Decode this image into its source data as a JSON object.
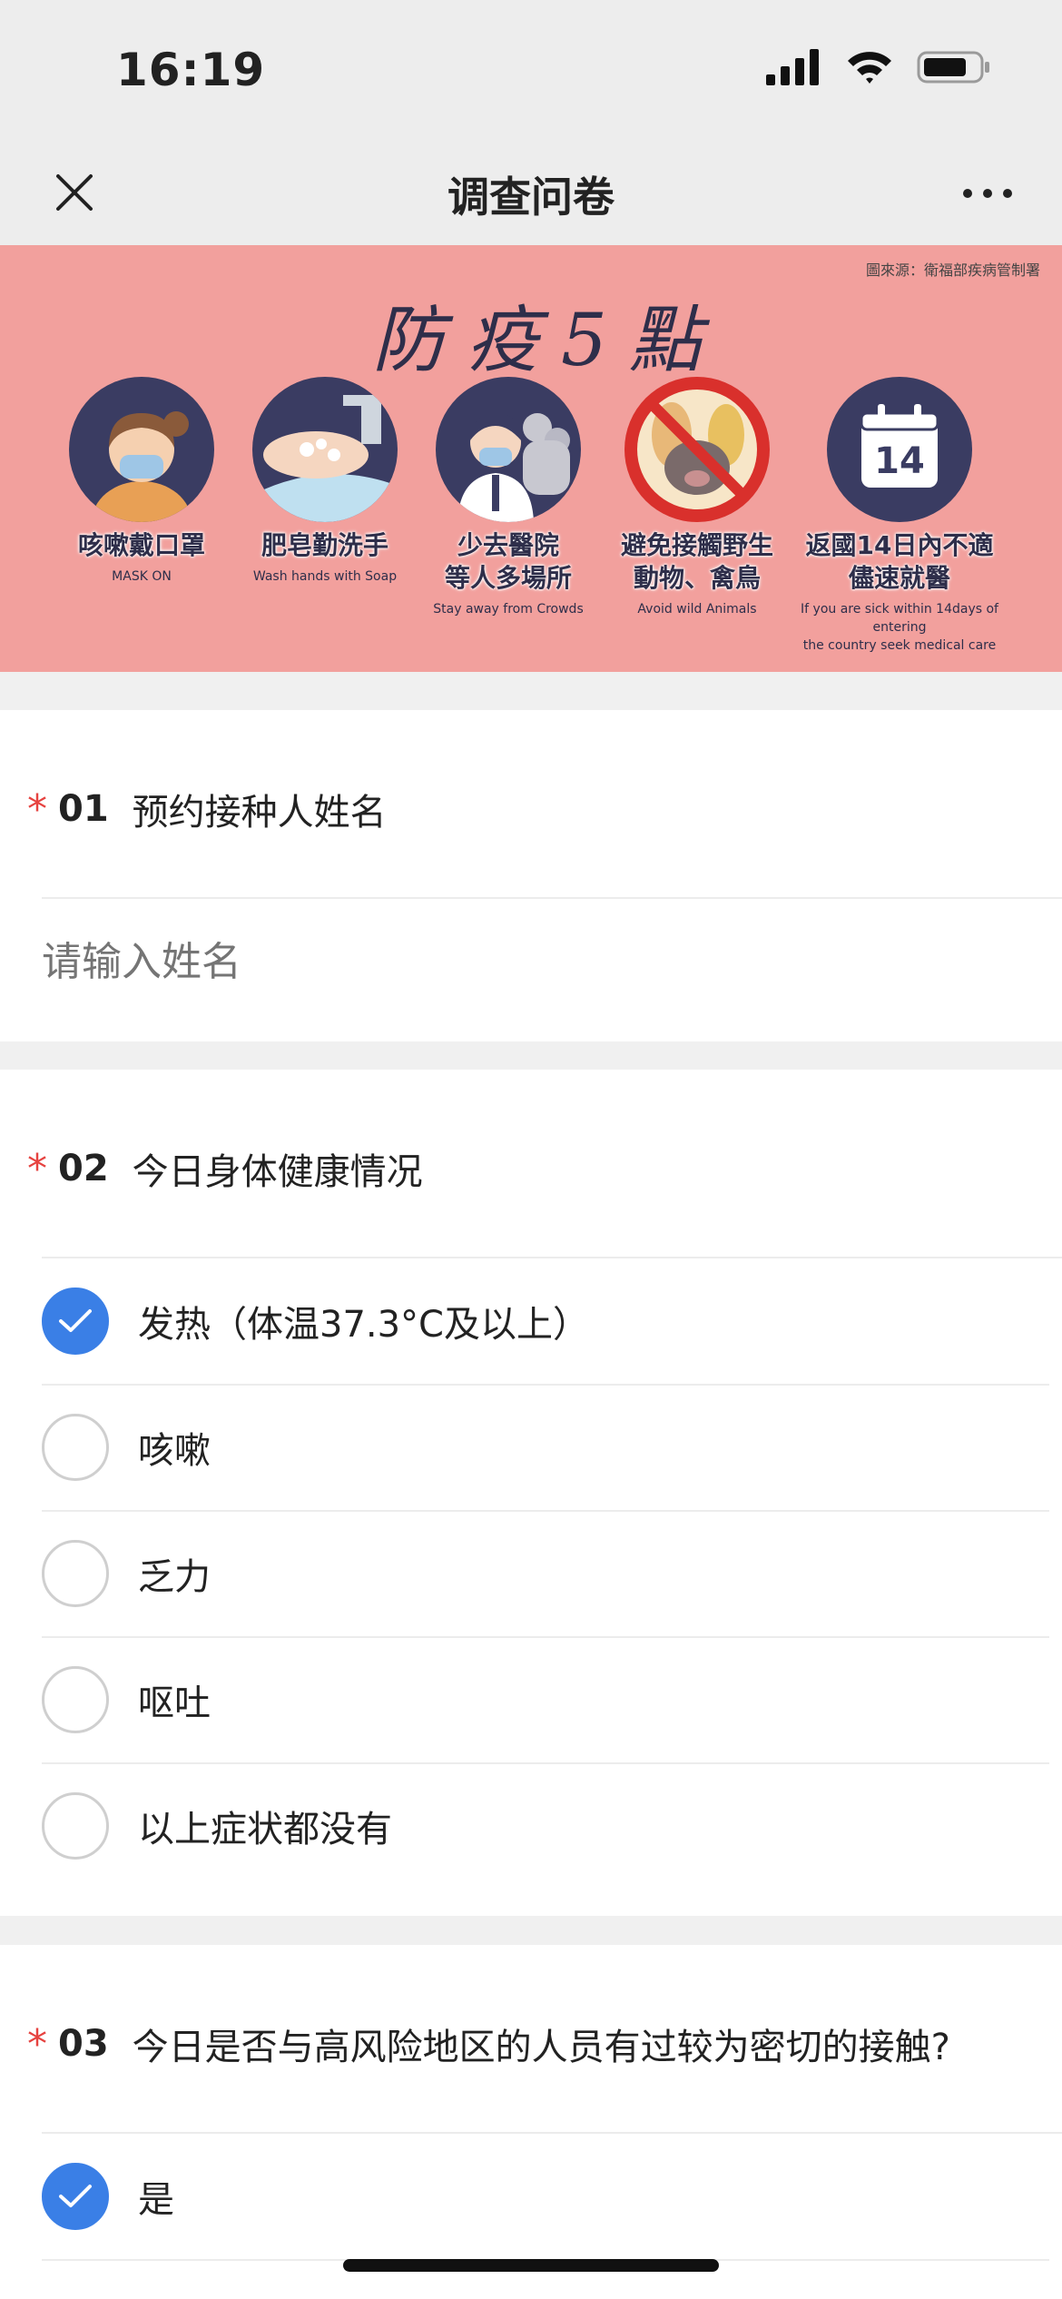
{
  "status_bar": {
    "time": "16:19"
  },
  "navbar": {
    "title": "调查问卷"
  },
  "banner": {
    "source": "圖來源：衛福部疾病管制署",
    "title": "防疫5點",
    "tips": [
      {
        "cn": "咳嗽戴口罩",
        "en": "MASK ON"
      },
      {
        "cn": "肥皂勤洗手",
        "en": "Wash hands with Soap"
      },
      {
        "cn": "少去醫院\n等人多場所",
        "en": "Stay away from Crowds"
      },
      {
        "cn": "避免接觸野生\n動物、禽鳥",
        "en": "Avoid wild Animals"
      },
      {
        "cn": "返國14日內不適\n儘速就醫",
        "en": "If you are sick within 14days of entering\nthe country seek medical care"
      }
    ],
    "calendar_number": "14"
  },
  "questions": [
    {
      "required": "*",
      "number": "01",
      "title": "预约接种人姓名",
      "placeholder": "请输入姓名",
      "value": ""
    },
    {
      "required": "*",
      "number": "02",
      "title": "今日身体健康情况",
      "options": [
        {
          "label": "发热（体温37.3°C及以上）",
          "checked": true
        },
        {
          "label": "咳嗽",
          "checked": false
        },
        {
          "label": "乏力",
          "checked": false
        },
        {
          "label": "呕吐",
          "checked": false
        },
        {
          "label": "以上症状都没有",
          "checked": false
        }
      ]
    },
    {
      "required": "*",
      "number": "03",
      "title": "今日是否与高风险地区的人员有过较为密切的接触?",
      "options": [
        {
          "label": "是",
          "checked": true
        }
      ]
    }
  ],
  "colors": {
    "accent": "#3a7fe6",
    "required": "#e64340",
    "banner_bg": "#f2a09d"
  }
}
